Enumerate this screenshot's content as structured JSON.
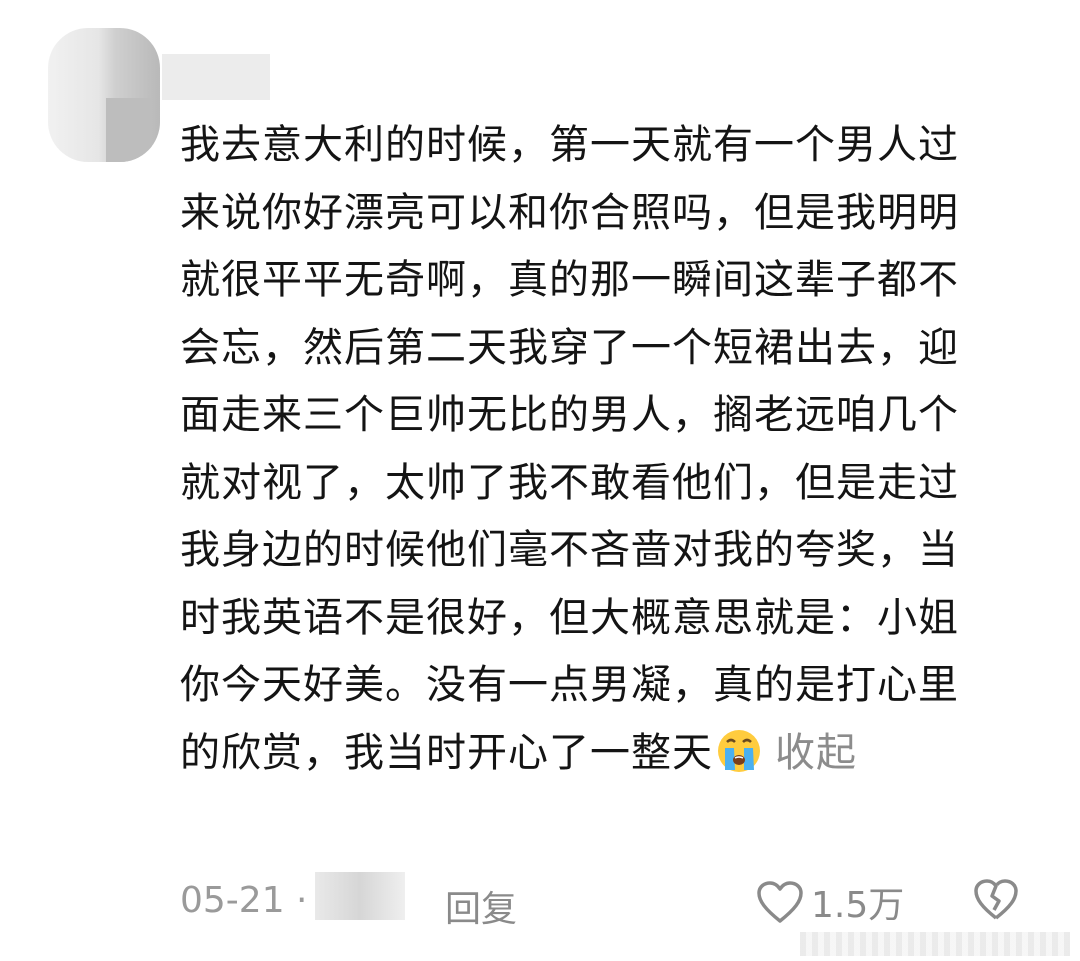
{
  "comment": {
    "text": "我去意大利的时候，第一天就有一个男人过来说你好漂亮可以和你合照吗，但是我明明就很平平无奇啊，真的那一瞬间这辈子都不会忘，然后第二天我穿了一个短裙出去，迎面走来三个巨帅无比的男人，搁老远咱几个就对视了，太帅了我不敢看他们，但是走过我身边的时候他们毫不吝啬对我的夸奖，当时我英语不是很好，但大概意思就是：小姐你今天好美。没有一点男凝，真的是打心里的欣赏，我当时开心了一整天",
    "collapse_label": "收起"
  },
  "footer": {
    "date": "05-21 ·",
    "reply_label": "回复",
    "like_count": "1.5万"
  },
  "icons": {
    "emoji": "crying-face-icon",
    "like": "heart-icon",
    "dislike": "broken-heart-icon"
  },
  "colors": {
    "text": "#141414",
    "muted": "#8a8a8a",
    "background": "#ffffff"
  }
}
